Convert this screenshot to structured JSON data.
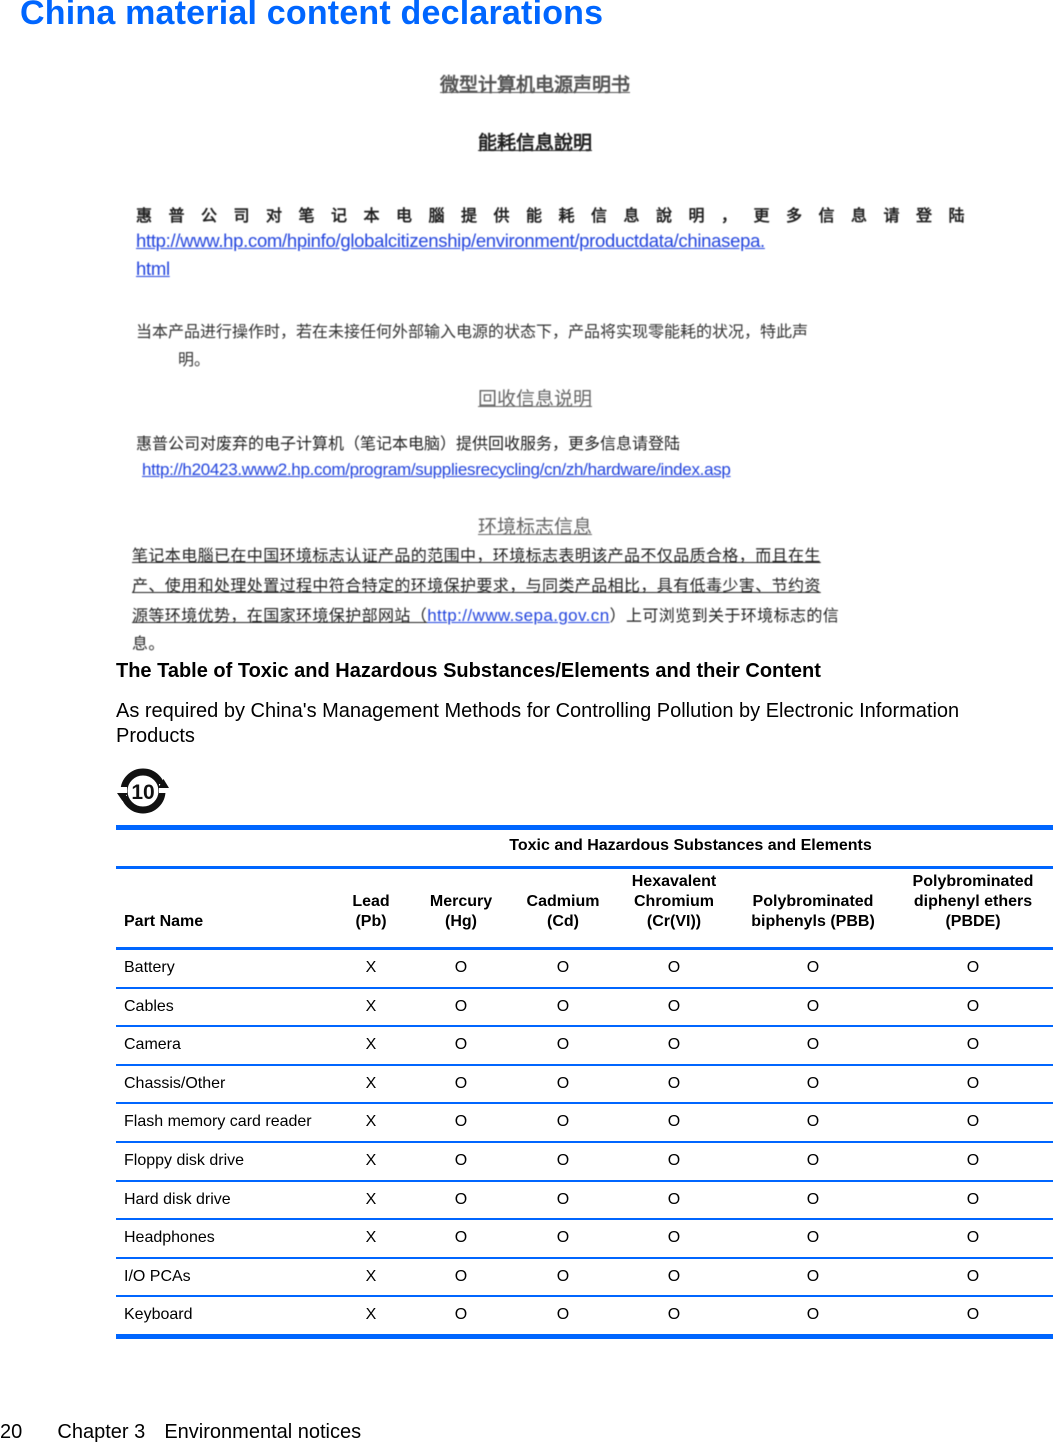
{
  "page": {
    "title": "China material content declarations",
    "footer": {
      "page_number": "20",
      "chapter": "Chapter 3",
      "section": "Environmental notices"
    }
  },
  "chinese_notice": {
    "heading_1": "微型计算机电源声明书",
    "heading_2": "能耗信息說明",
    "energy_para": "惠普公司对笔记本电腦提供能耗信息說明，更多信息请登陆",
    "energy_link_line1": "http://www.hp.com/hpinfo/globalcitizenship/environment/productdata/chinasepa.",
    "energy_link_line2": "html",
    "zero_power_line1": "当本产品进行操作时，若在未接任何外部输入电源的状态下，产品将实现零能耗的状况，特此声",
    "zero_power_line2": "明。",
    "heading_3": "回收信息说明",
    "recycling_para": "惠普公司对废弃的电子计算机（笔记本电脑）提供回收服务，更多信息请登陆",
    "recycling_link": "http://h20423.www2.hp.com/program/suppliesrecycling/cn/zh/hardware/index.asp",
    "heading_4": "环境标志信息",
    "ecolabel_line1": "笔记本电腦已在中国环境标志认证产品的范围中，环境标志表明该产品不仅品质合格，而且在生",
    "ecolabel_line2": "产、使用和处理处置过程中符合特定的环境保护要求，与同类产品相比，具有低毒少害、节约资",
    "ecolabel_line3_pre": "源等环境优势，在国家环境保护部网站（",
    "ecolabel_link": "http://www.sepa.gov.cn",
    "ecolabel_line3_post": "）上可浏览到关于环境标志的信",
    "ecolabel_line4": "息。"
  },
  "substances_section": {
    "heading": "The Table of Toxic and Hazardous Substances/Elements and their Content",
    "description": "As required by China's Management Methods for Controlling Pollution by Electronic Information Products",
    "logo": {
      "icon": "efup-10-icon",
      "label": "10"
    }
  },
  "table": {
    "group_header": "Toxic and Hazardous Substances and Elements",
    "columns": [
      {
        "key": "part",
        "label_lines": [
          "Part Name"
        ]
      },
      {
        "key": "pb",
        "label_lines": [
          "Lead",
          "(Pb)"
        ]
      },
      {
        "key": "hg",
        "label_lines": [
          "Mercury",
          "(Hg)"
        ]
      },
      {
        "key": "cd",
        "label_lines": [
          "Cadmium",
          "(Cd)"
        ]
      },
      {
        "key": "cr",
        "label_lines": [
          "Hexavalent",
          "Chromium",
          "(Cr(VI))"
        ]
      },
      {
        "key": "pbb",
        "label_lines": [
          "Polybrominated",
          "biphenyls (PBB)"
        ]
      },
      {
        "key": "pbde",
        "label_lines": [
          "Polybrominated",
          "diphenyl ethers",
          "(PBDE)"
        ]
      }
    ],
    "rows": [
      {
        "part": "Battery",
        "values": [
          "X",
          "O",
          "O",
          "O",
          "O",
          "O"
        ]
      },
      {
        "part": "Cables",
        "values": [
          "X",
          "O",
          "O",
          "O",
          "O",
          "O"
        ]
      },
      {
        "part": "Camera",
        "values": [
          "X",
          "O",
          "O",
          "O",
          "O",
          "O"
        ]
      },
      {
        "part": "Chassis/Other",
        "values": [
          "X",
          "O",
          "O",
          "O",
          "O",
          "O"
        ]
      },
      {
        "part": "Flash memory card reader",
        "values": [
          "X",
          "O",
          "O",
          "O",
          "O",
          "O"
        ]
      },
      {
        "part": "Floppy disk drive",
        "values": [
          "X",
          "O",
          "O",
          "O",
          "O",
          "O"
        ]
      },
      {
        "part": "Hard disk drive",
        "values": [
          "X",
          "O",
          "O",
          "O",
          "O",
          "O"
        ]
      },
      {
        "part": "Headphones",
        "values": [
          "X",
          "O",
          "O",
          "O",
          "O",
          "O"
        ]
      },
      {
        "part": "I/O PCAs",
        "values": [
          "X",
          "O",
          "O",
          "O",
          "O",
          "O"
        ]
      },
      {
        "part": "Keyboard",
        "values": [
          "X",
          "O",
          "O",
          "O",
          "O",
          "O"
        ]
      }
    ]
  },
  "colors": {
    "accent": "#0066ff",
    "link": "#2244dd"
  }
}
